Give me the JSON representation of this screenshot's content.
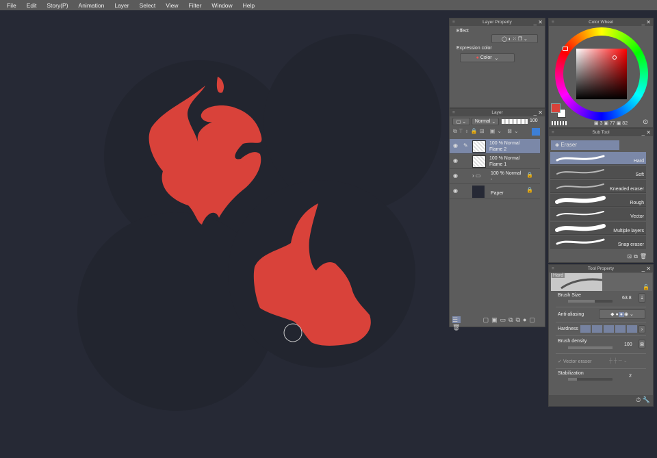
{
  "menu": [
    "File",
    "Edit",
    "Story(P)",
    "Animation",
    "Layer",
    "Select",
    "View",
    "Filter",
    "Window",
    "Help"
  ],
  "layer_property": {
    "title": "Layer Property",
    "effect_label": "Effect",
    "expression_label": "Expression color",
    "expression_value": "Color"
  },
  "layer_panel": {
    "title": "Layer",
    "blend_mode": "Normal",
    "opacity": "100",
    "layers": [
      {
        "line1": "100 % Normal",
        "line2": "Flame 2",
        "selected": true
      },
      {
        "line1": "100 % Normal",
        "line2": "Flame 1"
      },
      {
        "line1": "100 % Normal",
        "line2": "-"
      },
      {
        "line1": "",
        "line2": "Paper"
      }
    ]
  },
  "color_wheel": {
    "title": "Color Wheel",
    "h": "3",
    "s": "77",
    "v": "82",
    "main_color": "#d9423a",
    "sub_color": "#ffffff"
  },
  "sub_tool": {
    "title": "Sub Tool",
    "group": "Eraser",
    "items": [
      "Hard",
      "Soft",
      "Kneaded eraser",
      "Rough",
      "Vector",
      "Multiple layers",
      "Snap eraser"
    ]
  },
  "tool_property": {
    "title": "Tool Property",
    "preview_label": "Hard",
    "brush_size_label": "Brush Size",
    "brush_size": "63.8",
    "anti_aliasing_label": "Anti-aliasing",
    "hardness_label": "Hardness",
    "brush_density_label": "Brush density",
    "brush_density": "100",
    "vector_eraser_label": "Vector eraser",
    "stabilization_label": "Stabilization",
    "stabilization": "2"
  },
  "colors": {
    "canvas": "#262935",
    "flame": "#d9423a"
  }
}
